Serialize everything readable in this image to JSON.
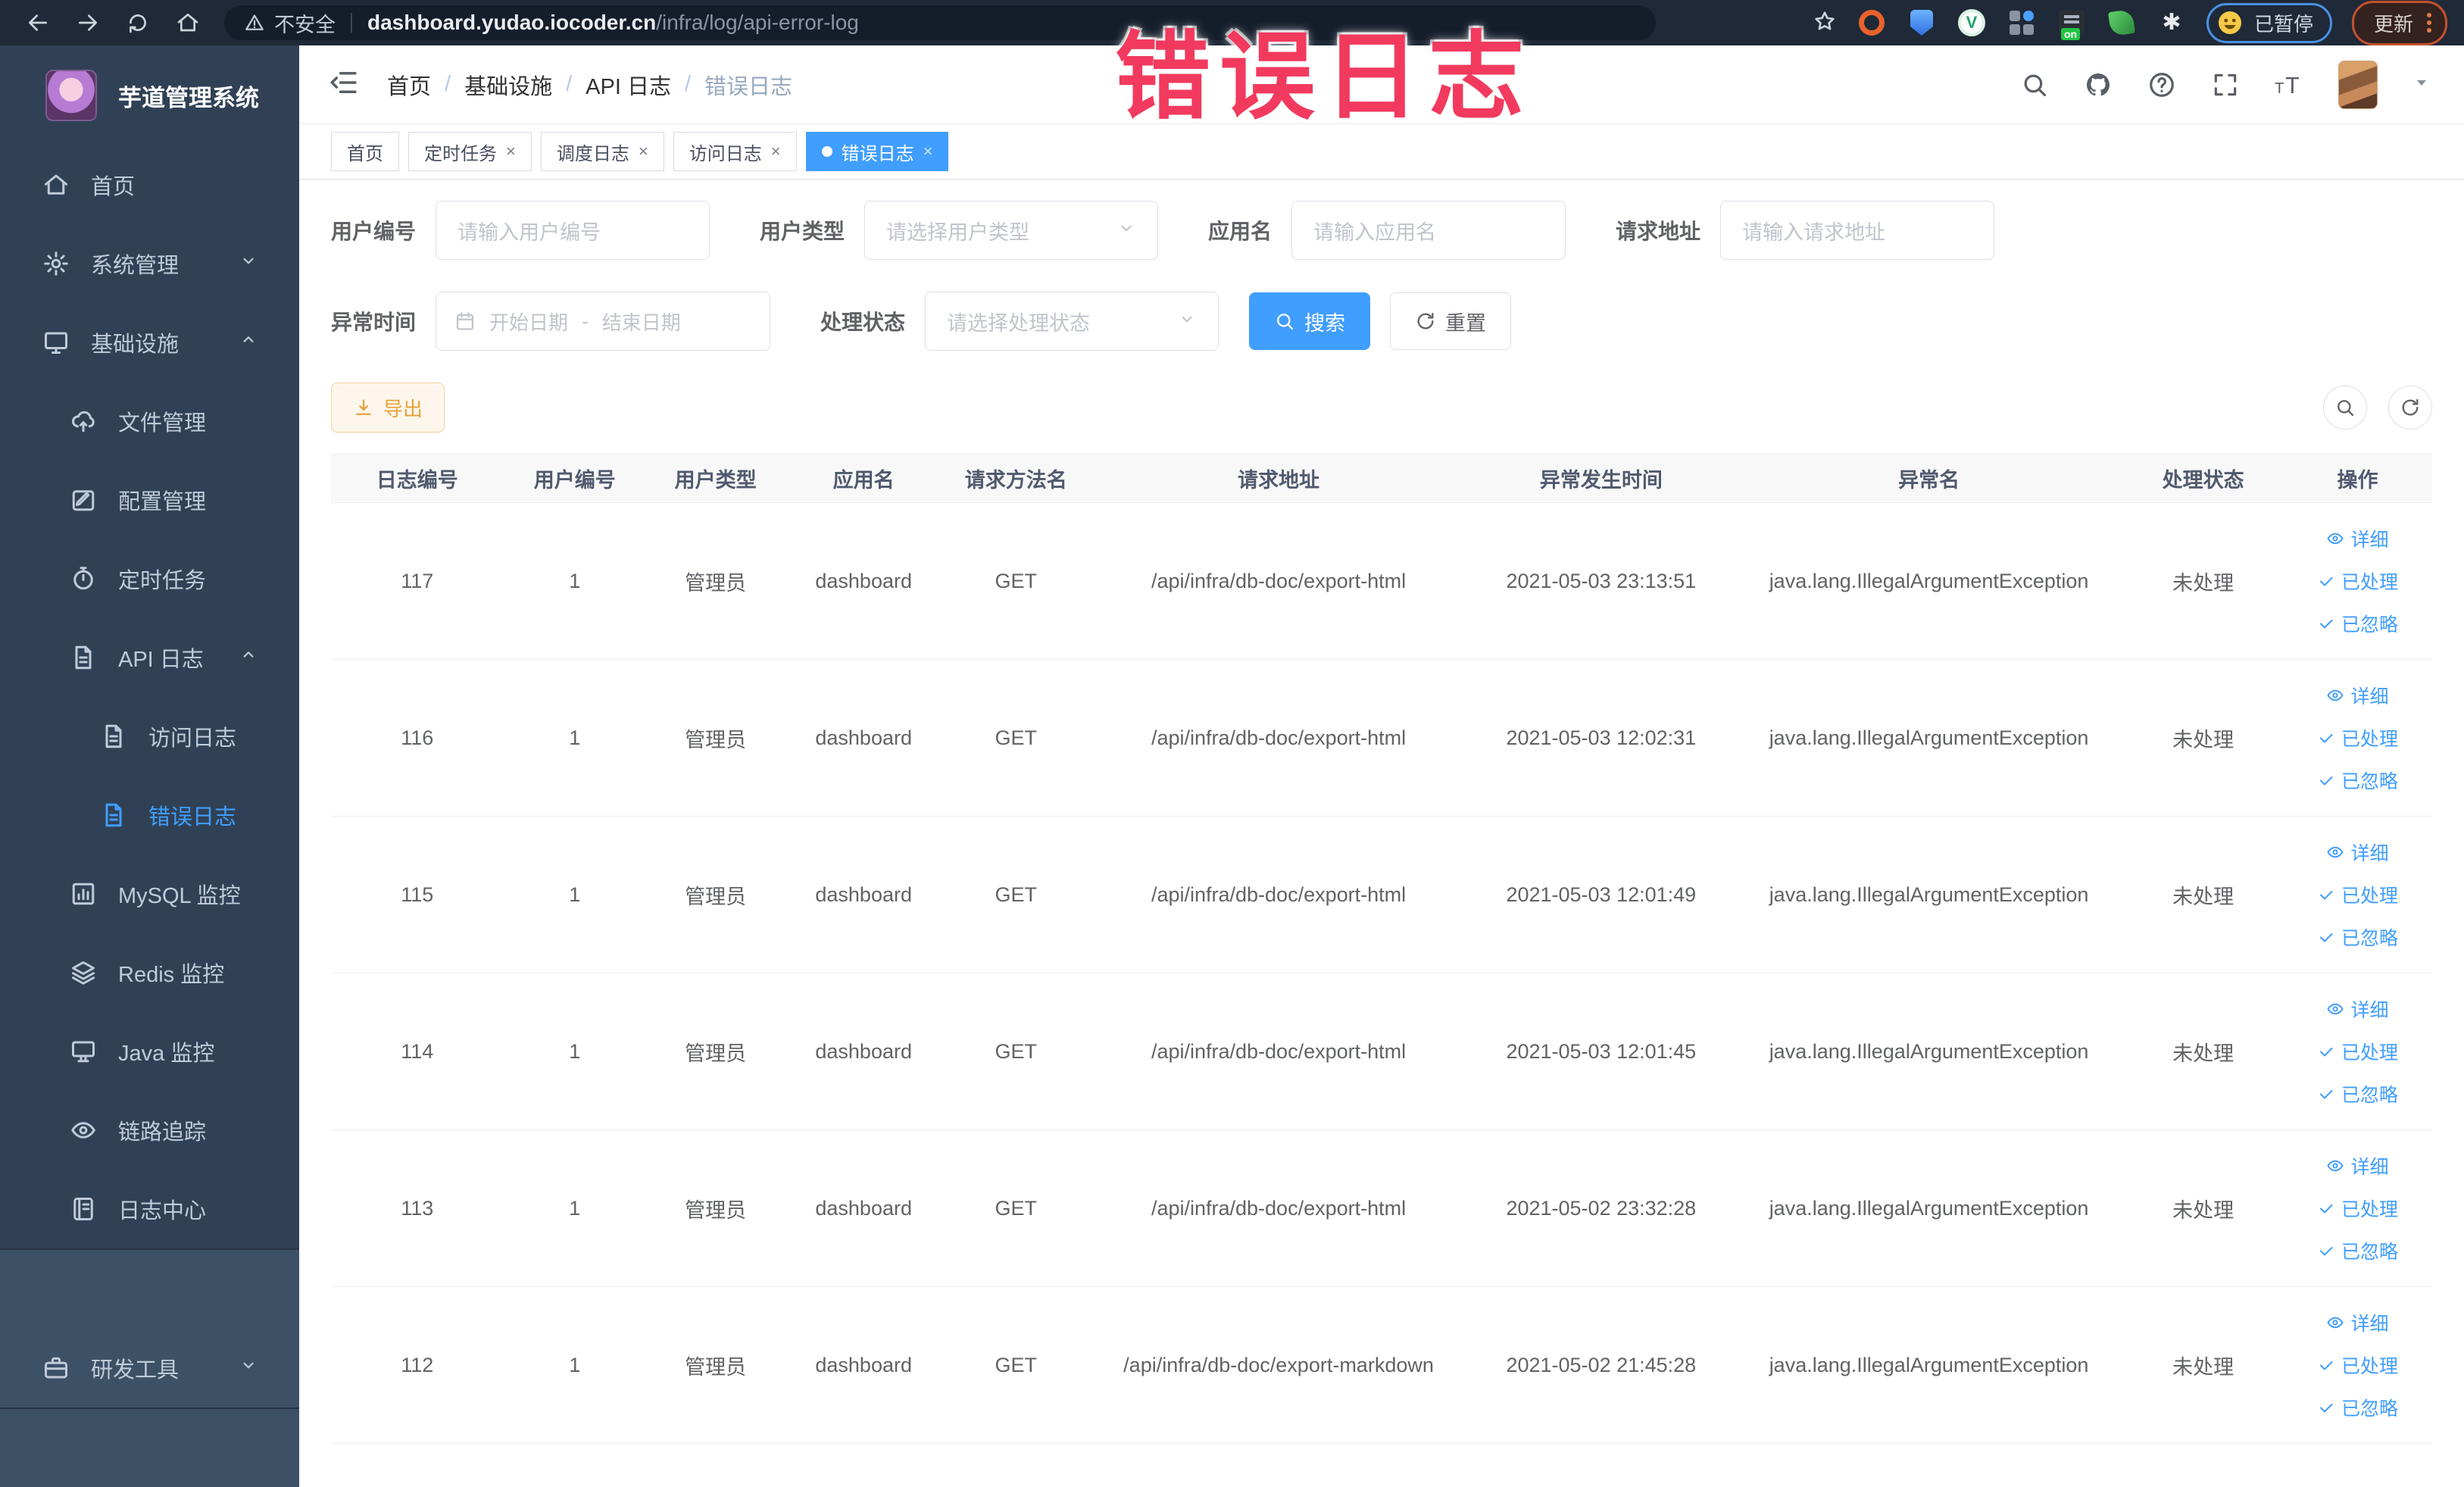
{
  "browser": {
    "security_label": "不安全",
    "url_host": "dashboard.yudao.iocoder.cn",
    "url_path": "/infra/log/api-error-log",
    "paused_label": "已暂停",
    "update_label": "更新",
    "extensions": [
      {
        "key": "orange-ring-extension"
      },
      {
        "key": "shield-extension"
      },
      {
        "key": "green-v-extension"
      },
      {
        "key": "grid-extension"
      },
      {
        "key": "on-badge-extension"
      },
      {
        "key": "leaf-extension"
      },
      {
        "key": "puzzle-extension"
      }
    ]
  },
  "annotation": {
    "text": "错误日志",
    "color": "#f23a5e"
  },
  "app_title": "芋道管理系统",
  "sidebar": {
    "items": [
      {
        "key": "home",
        "label": "首页",
        "icon": "home",
        "level": 1
      },
      {
        "key": "system-management",
        "label": "系统管理",
        "icon": "gear",
        "level": 1,
        "chevron": "down"
      },
      {
        "key": "infrastructure",
        "label": "基础设施",
        "icon": "monitor",
        "level": 1,
        "chevron": "up"
      },
      {
        "key": "file-management",
        "label": "文件管理",
        "icon": "cloud-upload",
        "level": 2
      },
      {
        "key": "config-management",
        "label": "配置管理",
        "icon": "edit",
        "level": 2
      },
      {
        "key": "scheduled-task",
        "label": "定时任务",
        "icon": "timer",
        "level": 2
      },
      {
        "key": "api-log",
        "label": "API 日志",
        "icon": "document",
        "level": 2,
        "chevron": "up"
      },
      {
        "key": "access-log",
        "label": "访问日志",
        "icon": "document",
        "level": 3
      },
      {
        "key": "error-log",
        "label": "错误日志",
        "icon": "document",
        "level": 3,
        "active": true
      },
      {
        "key": "mysql-monitor",
        "label": "MySQL 监控",
        "icon": "chart",
        "level": 2
      },
      {
        "key": "redis-monitor",
        "label": "Redis 监控",
        "icon": "layers",
        "level": 2
      },
      {
        "key": "java-monitor",
        "label": "Java 监控",
        "icon": "display",
        "level": 2
      },
      {
        "key": "trace",
        "label": "链路追踪",
        "icon": "eye",
        "level": 2
      },
      {
        "key": "log-center",
        "label": "日志中心",
        "icon": "notebook",
        "level": 2
      },
      {
        "key": "dev-tools",
        "label": "研发工具",
        "icon": "briefcase",
        "level": 1,
        "chevron": "down",
        "section": "light"
      }
    ]
  },
  "breadcrumb": [
    "首页",
    "基础设施",
    "API 日志",
    "错误日志"
  ],
  "tabs": [
    {
      "key": "home",
      "label": "首页",
      "closable": false,
      "active": false
    },
    {
      "key": "scheduled-task",
      "label": "定时任务",
      "closable": true,
      "active": false
    },
    {
      "key": "schedule-log",
      "label": "调度日志",
      "closable": true,
      "active": false
    },
    {
      "key": "access-log",
      "label": "访问日志",
      "closable": true,
      "active": false
    },
    {
      "key": "error-log",
      "label": "错误日志",
      "closable": true,
      "active": true
    }
  ],
  "filters": {
    "fields": [
      {
        "key": "user-id",
        "label": "用户编号",
        "placeholder": "请输入用户编号",
        "type": "input"
      },
      {
        "key": "user-type",
        "label": "用户类型",
        "placeholder": "请选择用户类型",
        "type": "select"
      },
      {
        "key": "app-name",
        "label": "应用名",
        "placeholder": "请输入应用名",
        "type": "input"
      },
      {
        "key": "request-url",
        "label": "请求地址",
        "placeholder": "请输入请求地址",
        "type": "input"
      }
    ],
    "time": {
      "label": "异常时间",
      "start_placeholder": "开始日期",
      "separator": "-",
      "end_placeholder": "结束日期"
    },
    "status": {
      "label": "处理状态",
      "placeholder": "请选择处理状态"
    },
    "search_label": "搜索",
    "reset_label": "重置"
  },
  "toolbar": {
    "export_label": "导出"
  },
  "table": {
    "headers": [
      "日志编号",
      "用户编号",
      "用户类型",
      "应用名",
      "请求方法名",
      "请求地址",
      "异常发生时间",
      "异常名",
      "处理状态",
      "操作"
    ],
    "actions": [
      {
        "key": "detail",
        "label": "详细",
        "icon": "eye"
      },
      {
        "key": "processed",
        "label": "已处理",
        "icon": "check"
      },
      {
        "key": "ignored",
        "label": "已忽略",
        "icon": "check"
      }
    ],
    "rows": [
      {
        "id": "117",
        "user_id": "1",
        "user_type": "管理员",
        "app_name": "dashboard",
        "method": "GET",
        "request_url": "/api/infra/db-doc/export-html",
        "time": "2021-05-03 23:13:51",
        "exception": "java.lang.IllegalArgumentException",
        "status": "未处理"
      },
      {
        "id": "116",
        "user_id": "1",
        "user_type": "管理员",
        "app_name": "dashboard",
        "method": "GET",
        "request_url": "/api/infra/db-doc/export-html",
        "time": "2021-05-03 12:02:31",
        "exception": "java.lang.IllegalArgumentException",
        "status": "未处理"
      },
      {
        "id": "115",
        "user_id": "1",
        "user_type": "管理员",
        "app_name": "dashboard",
        "method": "GET",
        "request_url": "/api/infra/db-doc/export-html",
        "time": "2021-05-03 12:01:49",
        "exception": "java.lang.IllegalArgumentException",
        "status": "未处理"
      },
      {
        "id": "114",
        "user_id": "1",
        "user_type": "管理员",
        "app_name": "dashboard",
        "method": "GET",
        "request_url": "/api/infra/db-doc/export-html",
        "time": "2021-05-03 12:01:45",
        "exception": "java.lang.IllegalArgumentException",
        "status": "未处理"
      },
      {
        "id": "113",
        "user_id": "1",
        "user_type": "管理员",
        "app_name": "dashboard",
        "method": "GET",
        "request_url": "/api/infra/db-doc/export-html",
        "time": "2021-05-02 23:32:28",
        "exception": "java.lang.IllegalArgumentException",
        "status": "未处理"
      },
      {
        "id": "112",
        "user_id": "1",
        "user_type": "管理员",
        "app_name": "dashboard",
        "method": "GET",
        "request_url": "/api/infra/db-doc/export-markdown",
        "time": "2021-05-02 21:45:28",
        "exception": "java.lang.IllegalArgumentException",
        "status": "未处理"
      }
    ]
  },
  "colors": {
    "accent": "#409eff",
    "warning": "#e6a23c",
    "sidebar_bg": "#304156",
    "annotation": "#f23a5e"
  }
}
